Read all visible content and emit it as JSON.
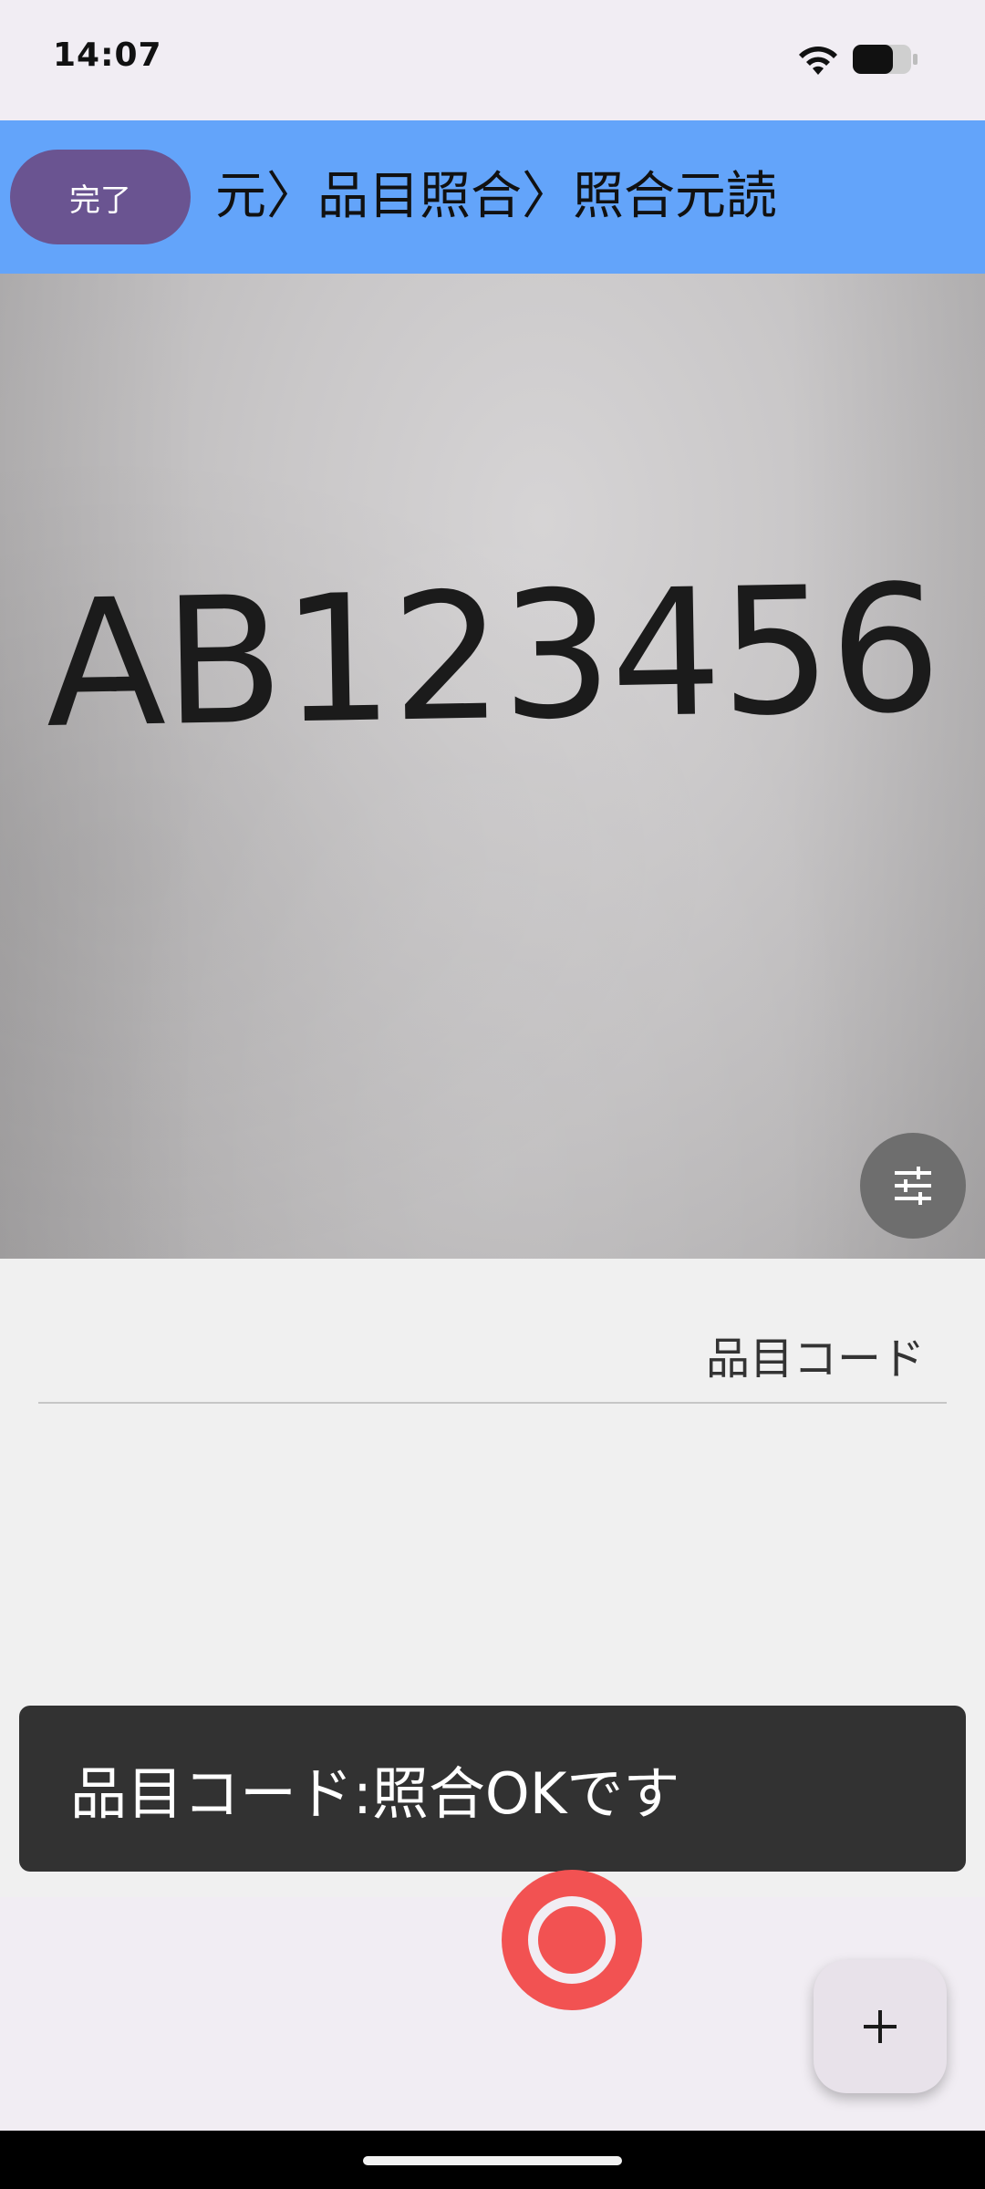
{
  "status_bar": {
    "time": "14:07",
    "icons": [
      "wifi-icon",
      "battery-icon"
    ]
  },
  "header": {
    "done_label": "完了",
    "breadcrumb": "元〉品目照合〉照合元読",
    "background_color": "#63a4fa",
    "button_color": "#6a5491"
  },
  "camera": {
    "scanned_text": "AB123456",
    "settings_icon": "tune-sliders-icon"
  },
  "form": {
    "field_label": "品目コード"
  },
  "snackbar": {
    "message": "品目コード:照合OKです"
  },
  "controls": {
    "shutter_icon": "shutter-record-icon",
    "shutter_color": "#f25252",
    "add_label": "+"
  }
}
